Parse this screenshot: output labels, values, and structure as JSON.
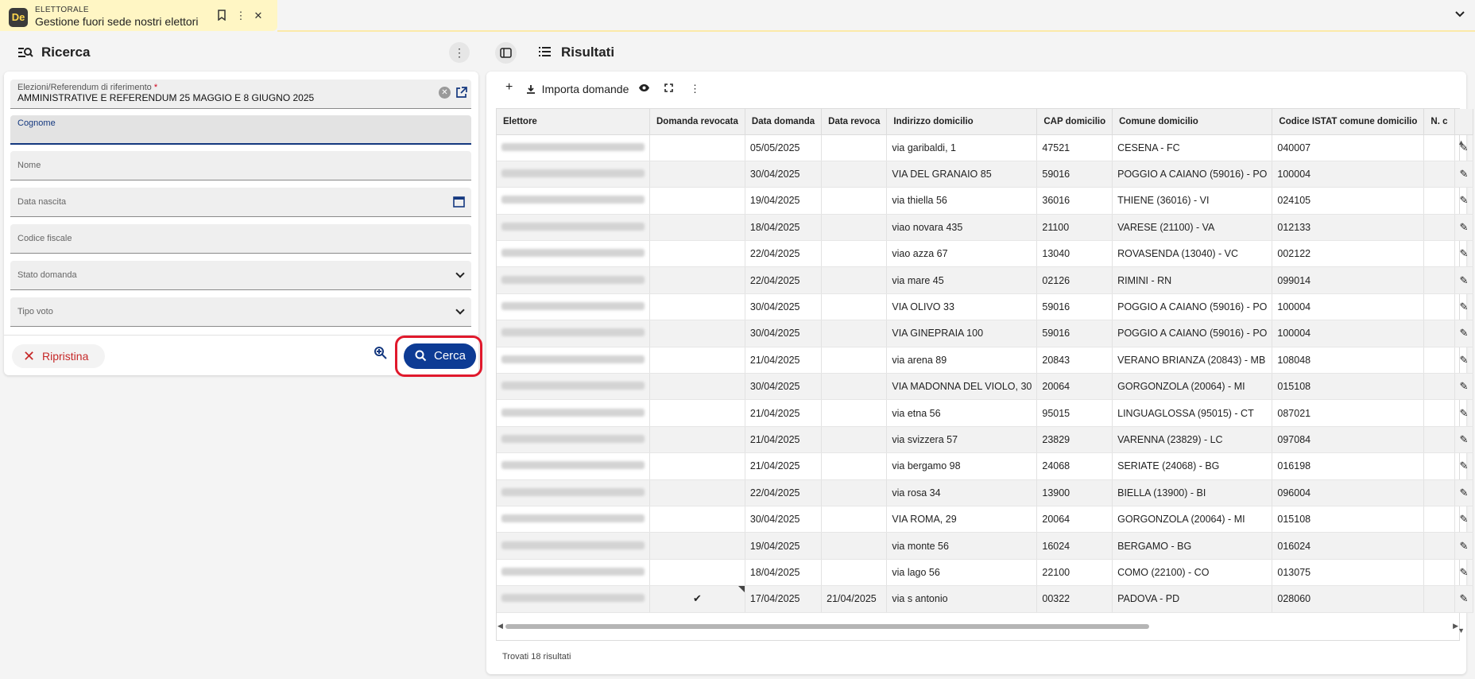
{
  "app_tab": {
    "app_name": "ELETTORALE",
    "document_title": "Gestione fuori sede nostri elettori",
    "logo_text": "De"
  },
  "search_panel": {
    "title": "Ricerca",
    "fields": {
      "election_label": "Elezioni/Referendum di riferimento",
      "election_value": "AMMINISTRATIVE E REFERENDUM 25 MAGGIO E 8 GIUGNO 2025",
      "surname_label": "Cognome",
      "name_label": "Nome",
      "birthdate_label": "Data nascita",
      "tax_code_label": "Codice fiscale",
      "status_label": "Stato domanda",
      "vote_type_label": "Tipo voto"
    },
    "reset_label": "Ripristina",
    "search_label": "Cerca"
  },
  "results_panel": {
    "title": "Risultati",
    "import_label": "Importa domande",
    "columns": [
      "Elettore",
      "Domanda revocata",
      "Data domanda",
      "Data revoca",
      "Indirizzo domicilio",
      "CAP domicilio",
      "Comune domicilio",
      "Codice ISTAT comune domicilio",
      "N. c"
    ],
    "rows": [
      {
        "revoked": false,
        "date": "05/05/2025",
        "revoke_date": "",
        "address": "via garibaldi, 1",
        "cap": "47521",
        "city": "CESENA - FC",
        "istat": "040007"
      },
      {
        "revoked": false,
        "date": "30/04/2025",
        "revoke_date": "",
        "address": "VIA DEL GRANAIO 85",
        "cap": "59016",
        "city": "POGGIO A CAIANO (59016) - PO",
        "istat": "100004"
      },
      {
        "revoked": false,
        "date": "19/04/2025",
        "revoke_date": "",
        "address": "via thiella 56",
        "cap": "36016",
        "city": "THIENE (36016) - VI",
        "istat": "024105"
      },
      {
        "revoked": false,
        "date": "18/04/2025",
        "revoke_date": "",
        "address": "viao novara 435",
        "cap": "21100",
        "city": "VARESE (21100) - VA",
        "istat": "012133"
      },
      {
        "revoked": false,
        "date": "22/04/2025",
        "revoke_date": "",
        "address": "viao azza 67",
        "cap": "13040",
        "city": "ROVASENDA (13040) - VC",
        "istat": "002122"
      },
      {
        "revoked": false,
        "date": "22/04/2025",
        "revoke_date": "",
        "address": "via mare 45",
        "cap": "02126",
        "city": "RIMINI - RN",
        "istat": "099014"
      },
      {
        "revoked": false,
        "date": "30/04/2025",
        "revoke_date": "",
        "address": "VIA OLIVO 33",
        "cap": "59016",
        "city": "POGGIO A CAIANO (59016) - PO",
        "istat": "100004"
      },
      {
        "revoked": false,
        "date": "30/04/2025",
        "revoke_date": "",
        "address": "VIA GINEPRAIA 100",
        "cap": "59016",
        "city": "POGGIO A CAIANO (59016) - PO",
        "istat": "100004"
      },
      {
        "revoked": false,
        "date": "21/04/2025",
        "revoke_date": "",
        "address": "via arena 89",
        "cap": "20843",
        "city": "VERANO BRIANZA (20843) - MB",
        "istat": "108048"
      },
      {
        "revoked": false,
        "date": "30/04/2025",
        "revoke_date": "",
        "address": "VIA MADONNA DEL VIOLO, 30",
        "cap": "20064",
        "city": "GORGONZOLA (20064) - MI",
        "istat": "015108"
      },
      {
        "revoked": false,
        "date": "21/04/2025",
        "revoke_date": "",
        "address": "via etna 56",
        "cap": "95015",
        "city": "LINGUAGLOSSA (95015) - CT",
        "istat": "087021"
      },
      {
        "revoked": false,
        "date": "21/04/2025",
        "revoke_date": "",
        "address": "via svizzera 57",
        "cap": "23829",
        "city": "VARENNA (23829) - LC",
        "istat": "097084"
      },
      {
        "revoked": false,
        "date": "21/04/2025",
        "revoke_date": "",
        "address": "via bergamo 98",
        "cap": "24068",
        "city": "SERIATE (24068) - BG",
        "istat": "016198"
      },
      {
        "revoked": false,
        "date": "22/04/2025",
        "revoke_date": "",
        "address": "via rosa 34",
        "cap": "13900",
        "city": "BIELLA (13900) - BI",
        "istat": "096004"
      },
      {
        "revoked": false,
        "date": "30/04/2025",
        "revoke_date": "",
        "address": "VIA ROMA, 29",
        "cap": "20064",
        "city": "GORGONZOLA (20064) - MI",
        "istat": "015108"
      },
      {
        "revoked": false,
        "date": "19/04/2025",
        "revoke_date": "",
        "address": "via monte 56",
        "cap": "16024",
        "city": "BERGAMO - BG",
        "istat": "016024"
      },
      {
        "revoked": false,
        "date": "18/04/2025",
        "revoke_date": "",
        "address": "via lago 56",
        "cap": "22100",
        "city": "COMO (22100) - CO",
        "istat": "013075"
      },
      {
        "revoked": true,
        "date": "17/04/2025",
        "revoke_date": "21/04/2025",
        "address": "via s antonio",
        "cap": "00322",
        "city": "PADOVA - PD",
        "istat": "028060"
      }
    ],
    "footer": "Trovati 18 risultati"
  },
  "icons": {
    "check": "✔",
    "edit": "✎"
  }
}
